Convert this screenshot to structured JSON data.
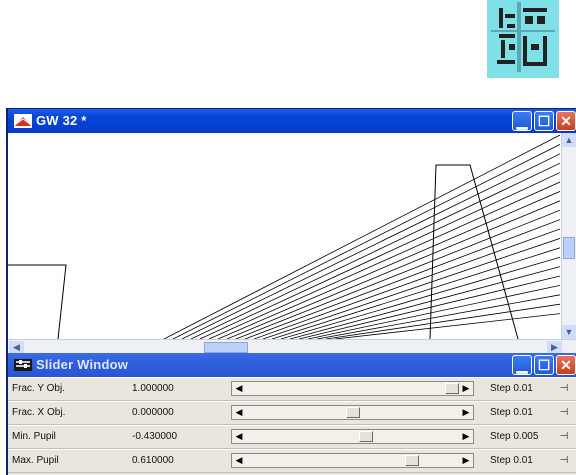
{
  "gw_window": {
    "title": "GW 32 *"
  },
  "slider_window": {
    "title": "Slider Window",
    "rows": [
      {
        "label": "Frac. Y Obj.",
        "value": "1.000000",
        "step": "Step 0.01",
        "position": 1.0
      },
      {
        "label": "Frac. X Obj.",
        "value": "0.000000",
        "step": "Step 0.01",
        "position": 0.5
      },
      {
        "label": "Min. Pupil",
        "value": "-0.430000",
        "step": "Step 0.005",
        "position": 0.57
      },
      {
        "label": "Max. Pupil",
        "value": "0.610000",
        "step": "Step 0.01",
        "position": 0.8
      }
    ]
  },
  "icons": {
    "app": "app-icon",
    "window_control": [
      "minimize-icon",
      "maximize-icon",
      "close-icon"
    ]
  },
  "colors": {
    "title_bar": "#0041d4",
    "close_button": "#c8401f",
    "canvas_background": "#ffffff",
    "slider_panel": "#e9e6de"
  }
}
